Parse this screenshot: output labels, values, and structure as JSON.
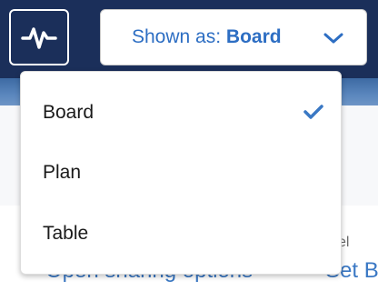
{
  "header": {
    "activity_icon": "activity-pulse-icon",
    "view_selector": {
      "prefix": "Shown as: ",
      "value": "Board",
      "icon": "chevron-down-icon"
    }
  },
  "dropdown": {
    "options": [
      {
        "label": "Board",
        "selected": true
      },
      {
        "label": "Plan",
        "selected": false
      },
      {
        "label": "Table",
        "selected": false
      }
    ],
    "check_icon": "checkmark-icon"
  },
  "background": {
    "link_left": "Open sharing options",
    "link_right": "Set B",
    "text_right": "el"
  },
  "colors": {
    "header_bg": "#1b2f5a",
    "accent_blue": "#2d6ec3",
    "link_blue": "#3a78c4"
  }
}
